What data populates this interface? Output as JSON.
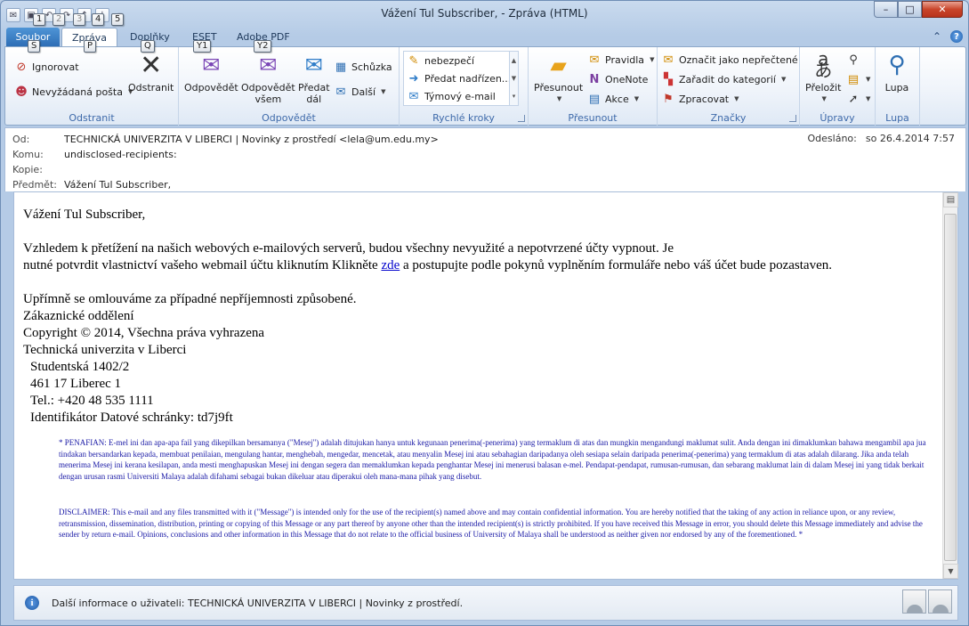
{
  "window": {
    "title": "Vážení Tul Subscriber,  - Zpráva (HTML)",
    "minimize": "–",
    "maximize": "□",
    "close": "✕"
  },
  "qat": {
    "keytips": [
      "1",
      "2",
      "3",
      "4",
      "5"
    ]
  },
  "tabs": {
    "file": "Soubor",
    "message": "Zpráva",
    "addins": "Doplňky",
    "eset": "ESET",
    "adobe": "Adobe PDF",
    "keytips": {
      "file": "S",
      "message": "P",
      "addins": "Q",
      "eset": "Y1",
      "adobe": "Y2"
    }
  },
  "ribbon": {
    "groups": {
      "delete": {
        "label": "Odstranit",
        "ignore": "Ignorovat",
        "junk": "Nevyžádaná pošta",
        "delete_btn": "Odstranit"
      },
      "respond": {
        "label": "Odpovědět",
        "reply": "Odpovědět",
        "reply_all_1": "Odpovědět",
        "reply_all_2": "všem",
        "forward_1": "Předat",
        "forward_2": "dál",
        "meeting": "Schůzka",
        "more": "Další"
      },
      "quicksteps": {
        "label": "Rychlé kroky",
        "items": [
          "nebezpečí",
          "Předat nadřízen...",
          "Týmový e-mail"
        ]
      },
      "move": {
        "label": "Přesunout",
        "move_btn": "Přesunout",
        "rules": "Pravidla",
        "onenote": "OneNote",
        "actions": "Akce"
      },
      "tags": {
        "label": "Značky",
        "mark_unread": "Označit jako nepřečtené",
        "categorize": "Zařadit do kategorií",
        "followup": "Zpracovat"
      },
      "editing": {
        "label": "Úpravy",
        "translate": "Přeložit"
      },
      "zoom": {
        "label": "Lupa",
        "zoom_btn": "Lupa"
      }
    }
  },
  "header": {
    "from_label": "Od:",
    "from_value": "TECHNICKÁ UNIVERZITA V LIBERCI | Novinky z prostředí <lela@um.edu.my>",
    "to_label": "Komu:",
    "to_value": "undisclosed-recipients:",
    "cc_label": "Kopie:",
    "cc_value": "",
    "subject_label": "Předmět:",
    "subject_value": "Vážení Tul Subscriber,",
    "sent_label": "Odesláno:",
    "sent_value": "so 26.4.2014 7:57"
  },
  "message": {
    "greeting": "Vážení Tul Subscriber,",
    "para1_line1": "Vzhledem k přetížení na našich webových e-mailových serverů, budou všechny nevyužité a nepotvrzené účty vypnout. Je",
    "para1_line2_a": "nutné potvrdit vlastnictví vašeho webmail účtu kliknutím Klikněte",
    "link": "zde",
    "para1_line2_b": " a postupujte podle pokynů vyplněním formuláře nebo váš účet bude pozastaven.",
    "apology": "Upřímně se omlouváme za případné nepříjemnosti způsobené.",
    "dept": "Zákaznické oddělení",
    "copyright": "Copyright © 2014, Všechna práva vyhrazena",
    "university": "Technická univerzita v Liberci",
    "street": "Studentská 1402/2",
    "city": "461 17 Liberec 1",
    "phone": "Tel.: +420 48 535 1111",
    "databox": "Identifikátor Datové schránky: td7j9ft",
    "penafian": "* PENAFIAN: E-mel ini dan apa-apa fail yang dikepilkan bersamanya (\"Mesej\") adalah ditujukan hanya untuk kegunaan penerima(-penerima) yang termaklum di atas dan mungkin mengandungi maklumat sulit. Anda dengan ini dimaklumkan bahawa mengambil apa jua tindakan bersandarkan kepada, membuat penilaian, mengulang hantar, menghebah, mengedar, mencetak, atau menyalin Mesej ini atau sebahagian daripadanya oleh sesiapa selain daripada penerima(-penerima) yang termaklum di atas adalah dilarang. Jika anda telah menerima Mesej ini kerana kesilapan, anda mesti menghapuskan Mesej ini dengan segera dan memaklumkan kepada penghantar Mesej ini menerusi balasan e-mel. Pendapat-pendapat, rumusan-rumusan, dan sebarang maklumat lain di dalam Mesej ini yang tidak berkait dengan urusan rasmi Universiti Malaya adalah difahami sebagai bukan dikeluar atau diperakui oleh mana-mana pihak yang disebut.",
    "disclaimer": "DISCLAIMER: This e-mail and any files transmitted with it (\"Message\") is intended only for the use of the recipient(s) named above and may contain confidential information. You are hereby notified that the taking of any action in reliance upon, or any review, retransmission, dissemination, distribution, printing or copying of this Message or any part thereof by anyone other than the intended recipient(s) is strictly prohibited. If you have received this Message in error, you should delete this Message immediately and advise the sender by return e-mail. Opinions, conclusions and other information in this Message that do not relate to the official business of University of Malaya shall be understood as neither given nor endorsed by any of the forementioned. *"
  },
  "infobar": {
    "text": "Další informace o uživateli: TECHNICKÁ UNIVERZITA V LIBERCI | Novinky z prostředí."
  },
  "colors": {
    "file_tab": "#2c6cb4",
    "link": "#0000cc",
    "fine_print": "#1a1aa6",
    "group_label": "#3e6aaa"
  }
}
